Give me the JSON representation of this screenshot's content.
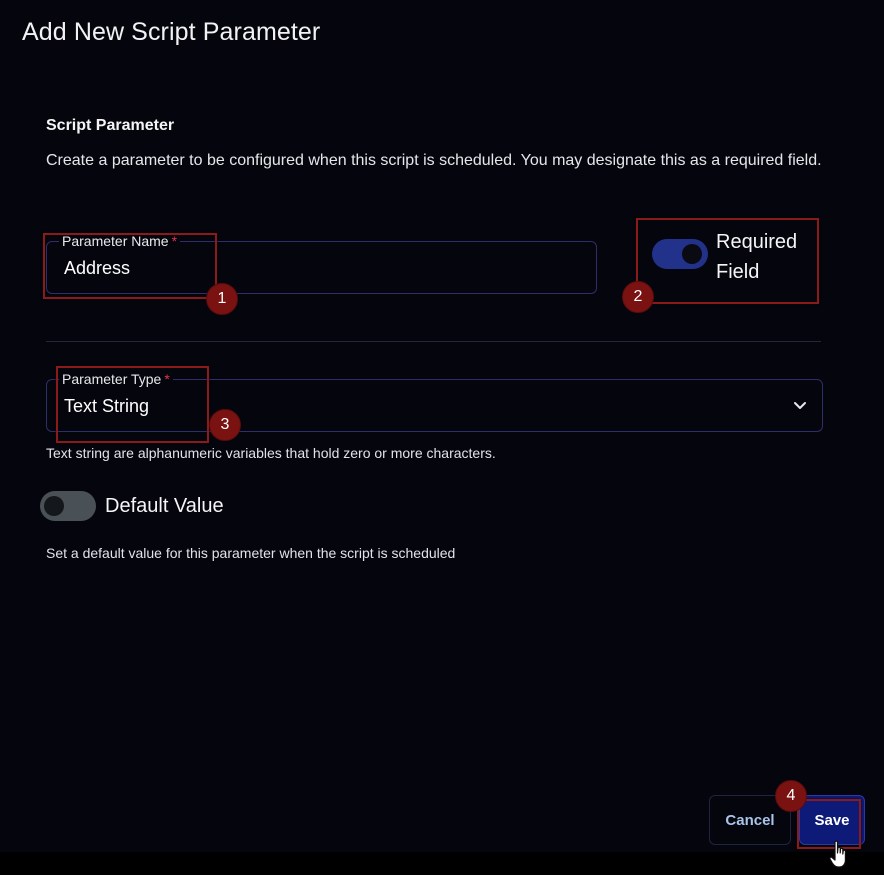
{
  "dialog": {
    "title": "Add New Script Parameter",
    "section_title": "Script Parameter",
    "section_description": "Create a parameter to be configured when this script is scheduled. You may designate this as a required field."
  },
  "parameter_name": {
    "label": "Parameter Name",
    "required_marker": "*",
    "value": "Address"
  },
  "required_field": {
    "label": "Required Field",
    "checked": true
  },
  "parameter_type": {
    "label": "Parameter Type",
    "required_marker": "*",
    "value": "Text String",
    "helper": "Text string are alphanumeric variables that hold zero or more characters."
  },
  "default_value": {
    "label": "Default Value",
    "checked": false,
    "helper": "Set a default value for this parameter when the script is scheduled"
  },
  "actions": {
    "cancel_label": "Cancel",
    "save_label": "Save"
  },
  "annotations": [
    "1",
    "2",
    "3",
    "4"
  ],
  "colors": {
    "background": "#05050e",
    "accent": "#0e1a78",
    "annotation": "#8b1a1a",
    "required_star": "#e0344a"
  }
}
